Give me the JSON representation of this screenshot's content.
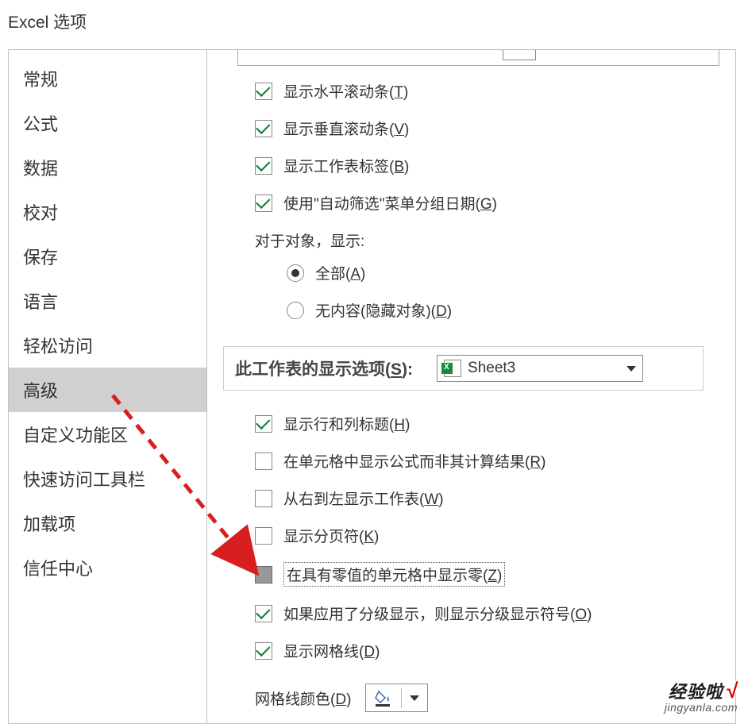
{
  "window_title": "Excel 选项",
  "sidebar": {
    "items": [
      {
        "label": "常规"
      },
      {
        "label": "公式"
      },
      {
        "label": "数据"
      },
      {
        "label": "校对"
      },
      {
        "label": "保存"
      },
      {
        "label": "语言"
      },
      {
        "label": "轻松访问"
      },
      {
        "label": "高级"
      },
      {
        "label": "自定义功能区"
      },
      {
        "label": "快速访问工具栏"
      },
      {
        "label": "加载项"
      },
      {
        "label": "信任中心"
      }
    ],
    "selected_index": 7
  },
  "section1": {
    "checks": [
      {
        "text": "显示水平滚动条(",
        "key": "T",
        "suffix": ")",
        "checked": true
      },
      {
        "text": "显示垂直滚动条(",
        "key": "V",
        "suffix": ")",
        "checked": true
      },
      {
        "text": "显示工作表标签(",
        "key": "B",
        "suffix": ")",
        "checked": true
      },
      {
        "text": "使用\"自动筛选\"菜单分组日期(",
        "key": "G",
        "suffix": ")",
        "checked": true
      }
    ],
    "obj_label": "对于对象，显示:",
    "radios": [
      {
        "text": "全部(",
        "key": "A",
        "suffix": ")",
        "selected": true
      },
      {
        "text": "无内容(隐藏对象)(",
        "key": "D",
        "suffix": ")",
        "selected": false
      }
    ]
  },
  "section2": {
    "header_prefix": "此工作表的显示选项(",
    "header_key": "S",
    "header_suffix": "):",
    "sheet_name": "Sheet3",
    "checks": [
      {
        "text": "显示行和列标题(",
        "key": "H",
        "suffix": ")",
        "checked": true,
        "focused": false
      },
      {
        "text": "在单元格中显示公式而非其计算结果(",
        "key": "R",
        "suffix": ")",
        "checked": false,
        "focused": false
      },
      {
        "text": "从右到左显示工作表(",
        "key": "W",
        "suffix": ")",
        "checked": false,
        "focused": false
      },
      {
        "text": "显示分页符(",
        "key": "K",
        "suffix": ")",
        "checked": false,
        "focused": false
      },
      {
        "text": "在具有零值的单元格中显示零(",
        "key": "Z",
        "suffix": ")",
        "checked": false,
        "focused": true,
        "indeterminate": true
      },
      {
        "text": "如果应用了分级显示，则显示分级显示符号(",
        "key": "O",
        "suffix": ")",
        "checked": true,
        "focused": false
      },
      {
        "text": "显示网格线(",
        "key": "D",
        "suffix": ")",
        "checked": true,
        "focused": false
      }
    ],
    "color_label_prefix": "网格线颜色(",
    "color_label_key": "D",
    "color_label_suffix": ")"
  },
  "watermark": {
    "line1": "经验啦",
    "check": "√",
    "line2": "jingyanla.com"
  }
}
